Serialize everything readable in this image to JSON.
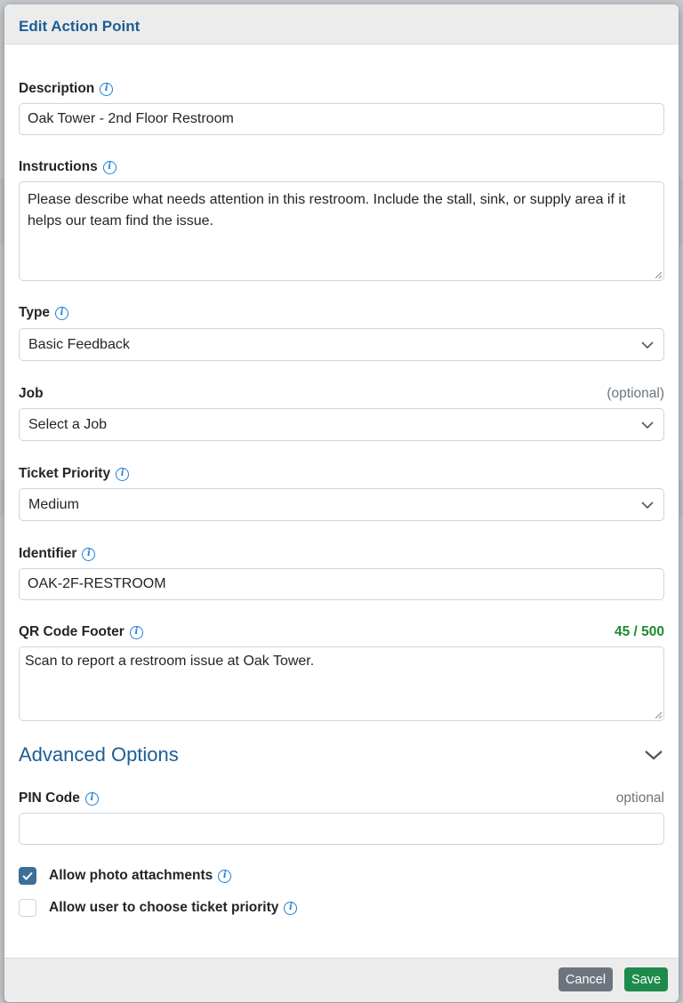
{
  "modal": {
    "title": "Edit Action Point"
  },
  "fields": {
    "description": {
      "label": "Description",
      "value": "Oak Tower - 2nd Floor Restroom"
    },
    "instructions": {
      "label": "Instructions",
      "value": "Please describe what needs attention in this restroom. Include the stall, sink, or supply area if it helps our team find the issue."
    },
    "type": {
      "label": "Type",
      "value": "Basic Feedback"
    },
    "job": {
      "label": "Job",
      "optional": "(optional)",
      "value": "Select a Job"
    },
    "ticket_priority": {
      "label": "Ticket Priority",
      "value": "Medium"
    },
    "identifier": {
      "label": "Identifier",
      "value": "OAK-2F-RESTROOM"
    },
    "qr_footer": {
      "label": "QR Code Footer",
      "counter": "45 / 500",
      "value": "Scan to report a restroom issue at Oak Tower."
    }
  },
  "advanced": {
    "title": "Advanced Options",
    "pin": {
      "label": "PIN Code",
      "optional": "optional",
      "value": ""
    },
    "allow_photo": {
      "label": "Allow photo attachments",
      "checked": true
    },
    "allow_priority": {
      "label": "Allow user to choose ticket priority",
      "checked": false
    }
  },
  "footer": {
    "cancel": "Cancel",
    "save": "Save"
  },
  "colors": {
    "brand": "#1b5e95",
    "info": "#1e7fd6",
    "save": "#1e8a4c",
    "cancel": "#6c757d",
    "counter": "#1e8a32"
  }
}
